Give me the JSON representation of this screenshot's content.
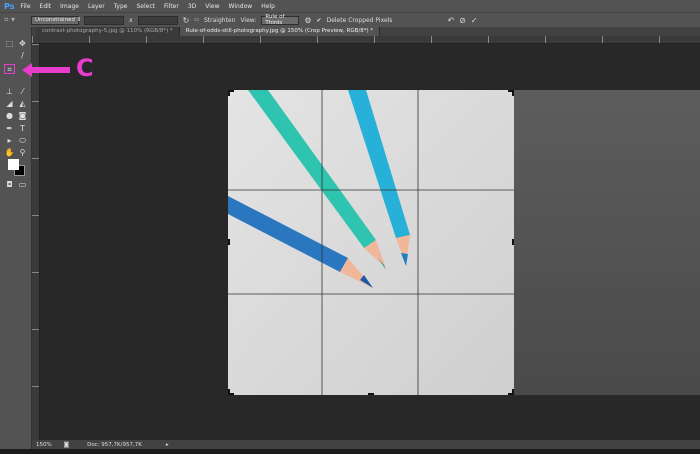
{
  "app": {
    "logo": "Ps"
  },
  "menu": [
    "File",
    "Edit",
    "Image",
    "Layer",
    "Type",
    "Select",
    "Filter",
    "3D",
    "View",
    "Window",
    "Help"
  ],
  "options": {
    "ratio": "Unconstrained",
    "width": "",
    "x_sep": "x",
    "height": "",
    "straighten": "Straighten",
    "view_label": "View:",
    "view_value": "Rule of Thirds",
    "delete_cropped": "Delete Cropped Pixels",
    "delete_cropped_checked": true
  },
  "tabs": [
    {
      "label": "contrast-photography-5.jpg @ 110% (RGB/8*) *",
      "active": false
    },
    {
      "label": "Rule-of-odds-still-photography.jpg @ 150% (Crop Preview, RGB/8*) *",
      "active": true
    }
  ],
  "annotation": {
    "label": "C",
    "color": "#e83ccc"
  },
  "status": {
    "zoom": "150%",
    "doc": "Doc: 957,7K/957,7K"
  },
  "crop_overlay": "rule-of-thirds"
}
